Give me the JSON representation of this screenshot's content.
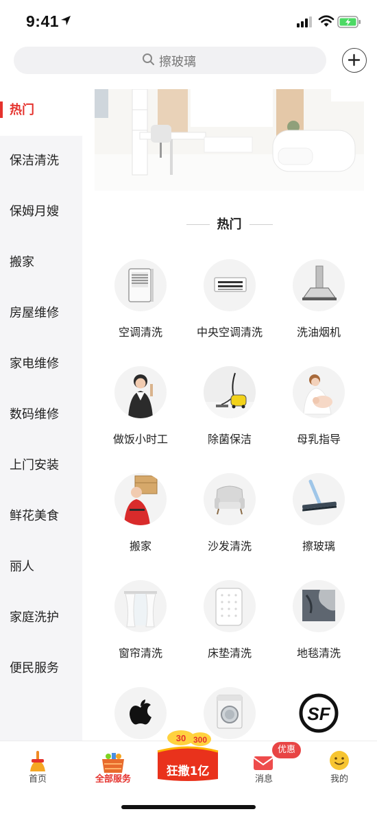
{
  "status_bar": {
    "time": "9:41"
  },
  "search": {
    "placeholder": "擦玻璃"
  },
  "sidebar": {
    "items": [
      {
        "label": "热门",
        "active": true
      },
      {
        "label": "保洁清洗"
      },
      {
        "label": "保姆月嫂"
      },
      {
        "label": "搬家"
      },
      {
        "label": "房屋维修"
      },
      {
        "label": "家电维修"
      },
      {
        "label": "数码维修"
      },
      {
        "label": "上门安装"
      },
      {
        "label": "鲜花美食"
      },
      {
        "label": "丽人"
      },
      {
        "label": "家庭洗护"
      },
      {
        "label": "便民服务"
      }
    ]
  },
  "section": {
    "title": "热门"
  },
  "services": [
    {
      "name": "空调清洗",
      "icon": "air-conditioner-icon"
    },
    {
      "name": "中央空调清洗",
      "icon": "central-ac-icon"
    },
    {
      "name": "洗油烟机",
      "icon": "range-hood-icon"
    },
    {
      "name": "做饭小时工",
      "icon": "cook-worker-icon"
    },
    {
      "name": "除菌保洁",
      "icon": "steam-cleaner-icon"
    },
    {
      "name": "母乳指导",
      "icon": "mother-baby-icon"
    },
    {
      "name": "搬家",
      "icon": "mover-icon"
    },
    {
      "name": "沙发清洗",
      "icon": "sofa-icon"
    },
    {
      "name": "擦玻璃",
      "icon": "squeegee-icon"
    },
    {
      "name": "窗帘清洗",
      "icon": "curtain-icon"
    },
    {
      "name": "床垫清洗",
      "icon": "mattress-icon"
    },
    {
      "name": "地毯清洗",
      "icon": "carpet-icon"
    },
    {
      "name": "",
      "icon": "apple-icon"
    },
    {
      "name": "",
      "icon": "washing-machine-icon"
    },
    {
      "name": "",
      "icon": "sf-express-icon"
    }
  ],
  "tab_bar": {
    "tabs": [
      {
        "label": "首页",
        "icon": "broom-icon"
      },
      {
        "label": "全部服务",
        "icon": "basket-icon",
        "active": true
      },
      {
        "label": "消息",
        "icon": "envelope-icon"
      },
      {
        "label": "我的",
        "icon": "smiley-icon"
      }
    ],
    "promo_label": "狂撒1亿",
    "promo_amounts": [
      "30",
      "300"
    ],
    "offer_badge": "优惠"
  },
  "colors": {
    "accent": "#e5322d",
    "sidebar_bg": "#f5f5f7",
    "battery": "#4cd964"
  }
}
